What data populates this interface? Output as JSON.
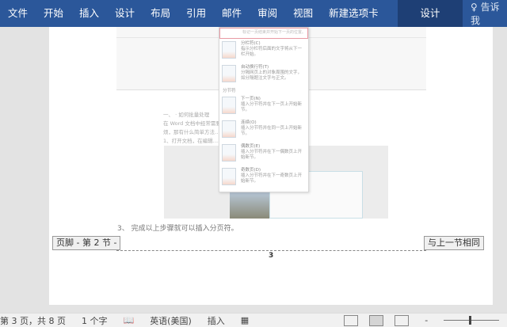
{
  "ribbon": {
    "tabs": [
      "文件",
      "开始",
      "插入",
      "设计",
      "布局",
      "引用",
      "邮件",
      "审阅",
      "视图",
      "新建选项卡"
    ],
    "context_tab": "设计",
    "tell_me": "告诉我"
  },
  "menu": {
    "top_desc": "标记一页结束并开始下一页的位置。",
    "items": [
      {
        "label": "分栏符(C)",
        "desc": "指示分栏符后面的文字将从下一栏开始。"
      },
      {
        "label": "自动换行符(T)",
        "desc": "分隔网页上的对象周围的文字，如分隔题注文字与正文。"
      }
    ],
    "section_header": "分节符",
    "section_items": [
      {
        "label": "下一页(N)",
        "desc": "插入分节符并在下一页上开始新节。"
      },
      {
        "label": "连续(O)",
        "desc": "插入分节符并在同一页上开始新节。"
      },
      {
        "label": "偶数页(E)",
        "desc": "插入分节符并在下一偶数页上开始新节。"
      },
      {
        "label": "奇数页(D)",
        "desc": "插入分节符并在下一奇数页上开始新节。"
      }
    ]
  },
  "document": {
    "line1": "一、 · 如何批量处理",
    "line2": "在 Word 文档中经常需要……，但加一张张对齐则会比较麻",
    "line3": "烦，那有什么简单方法……下操作步骤。",
    "line4": "1、打开文档，在编辑……也可以直接使用快捷键 Ctrl+",
    "step3": "3、 完成以上步骤就可以插入分页符。",
    "footer_label": "页脚 - 第 2 节 -",
    "same_as_previous": "与上一节相同",
    "page_number": "3"
  },
  "status": {
    "page": "第 3 页，共 8 页",
    "words": "1 个字",
    "language": "英语(美国)",
    "mode": "插入"
  }
}
